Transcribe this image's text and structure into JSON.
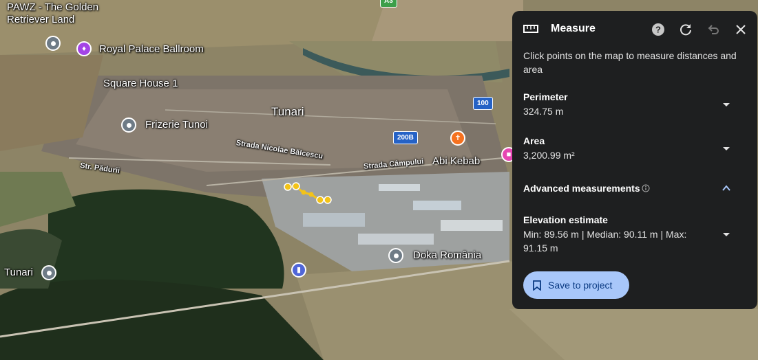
{
  "map": {
    "places": [
      {
        "id": "pawz",
        "name": "PAWZ - The Golden\nRetriever Land"
      },
      {
        "id": "royal",
        "name": "Royal Palace Ballroom"
      },
      {
        "id": "square",
        "name": "Square House 1"
      },
      {
        "id": "tunari-town",
        "name": "Tunari"
      },
      {
        "id": "frizerie",
        "name": "Frizerie Tunoi"
      },
      {
        "id": "abi",
        "name": "Abi Kebab"
      },
      {
        "id": "doka",
        "name": "Doka România"
      },
      {
        "id": "tunari-left",
        "name": "Tunari"
      }
    ],
    "streets": {
      "nicolae": "Strada Nicolae Bălcescu",
      "campului": "Strada Câmpului",
      "padurii": "Str. Pădurii"
    },
    "routes": {
      "r100": "100",
      "r200b": "200B",
      "a3": "A3"
    }
  },
  "panel": {
    "title": "Measure",
    "description": "Click points on the map to measure distances and area",
    "perimeter": {
      "label": "Perimeter",
      "value": "324.75 m"
    },
    "area": {
      "label": "Area",
      "value": "3,200.99 m²"
    },
    "advanced": {
      "label": "Advanced measurements"
    },
    "elevation": {
      "label": "Elevation estimate",
      "value": "Min: 89.56 m | Median: 90.11 m | Max: 91.15 m"
    },
    "save_label": "Save to project"
  },
  "colors": {
    "panel_bg": "#1e1f20",
    "save_bg": "#a8c7fa",
    "save_text": "#0a3a82",
    "measure_line": "#f3c318"
  }
}
